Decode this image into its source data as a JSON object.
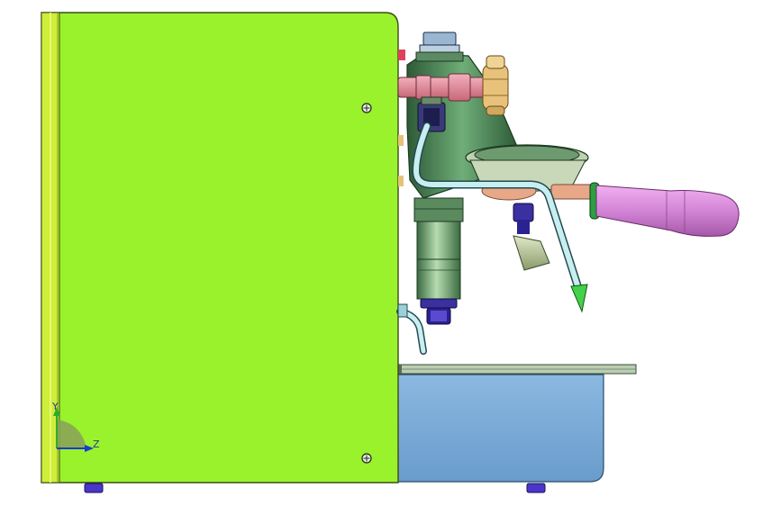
{
  "triad": {
    "y_label": "Y",
    "z_label": "Z"
  },
  "colors": {
    "background": "#ffffff",
    "body_panel": "#99f22b",
    "body_edge": "#3c4a18",
    "side_strip": "#d8f04a",
    "drip_tray": "#72a8d6",
    "group_head": "#3f7a4a",
    "steam_tube": "#c8eef0",
    "valve_pink": "#e88a9a",
    "knob_gold": "#e8c27a",
    "handle_pink": "#d88ad8",
    "portafilter": "#b8c8a0",
    "nozzle_green": "#44d04a",
    "feet_purple": "#4a36c8",
    "axis_y": "#2faa2f",
    "axis_x": "#1a3ad0"
  },
  "icons": {
    "screw": "phillips-screw-icon",
    "triad": "coordinate-triad-icon"
  }
}
